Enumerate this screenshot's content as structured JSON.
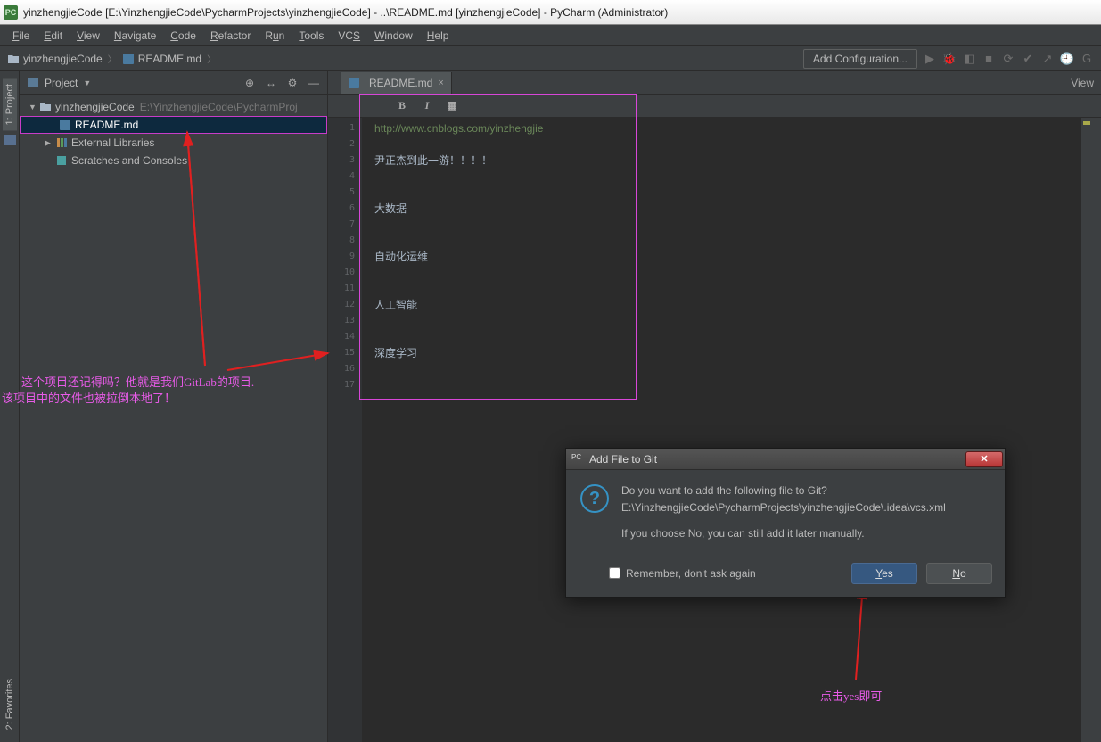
{
  "window": {
    "title": "yinzhengjieCode [E:\\YinzhengjieCode\\PycharmProjects\\yinzhengjieCode] - ..\\README.md [yinzhengjieCode] - PyCharm (Administrator)"
  },
  "menu": {
    "items": [
      "File",
      "Edit",
      "View",
      "Navigate",
      "Code",
      "Refactor",
      "Run",
      "Tools",
      "VCS",
      "Window",
      "Help"
    ]
  },
  "breadcrumb": {
    "root": "yinzhengjieCode",
    "file": "README.md"
  },
  "toolbar": {
    "add_config": "Add Configuration...",
    "right_view": "View"
  },
  "project_tool": {
    "title": "Project",
    "root": {
      "name": "yinzhengjieCode",
      "path": "E:\\YinzhengjieCode\\PycharmProj"
    },
    "readme": "README.md",
    "ext_libs": "External Libraries",
    "scratches": "Scratches and Consoles"
  },
  "left_tabs": {
    "project": "1: Project",
    "favorites": "2: Favorites"
  },
  "editor": {
    "tab": "README.md",
    "lines": [
      "http://www.cnblogs.com/yinzhengjie",
      "",
      "尹正杰到此一游！！！！",
      "",
      "",
      "大数据",
      "",
      "",
      "自动化运维",
      "",
      "",
      "人工智能",
      "",
      "",
      "深度学习",
      "",
      ""
    ]
  },
  "dialog": {
    "title": "Add File to Git",
    "line1": "Do you want to add the following file to Git?",
    "line2": "E:\\YinzhengjieCode\\PycharmProjects\\yinzhengjieCode\\.idea\\vcs.xml",
    "line3": "If you choose No, you can still add it later manually.",
    "remember": "Remember, don't ask again",
    "yes": "Yes",
    "no": "No"
  },
  "annotations": {
    "left1": "这个项目还记得吗？他就是我们GitLab的项目.",
    "left2": "该项目中的文件也被拉倒本地了！",
    "bottom": "点击yes即可"
  }
}
